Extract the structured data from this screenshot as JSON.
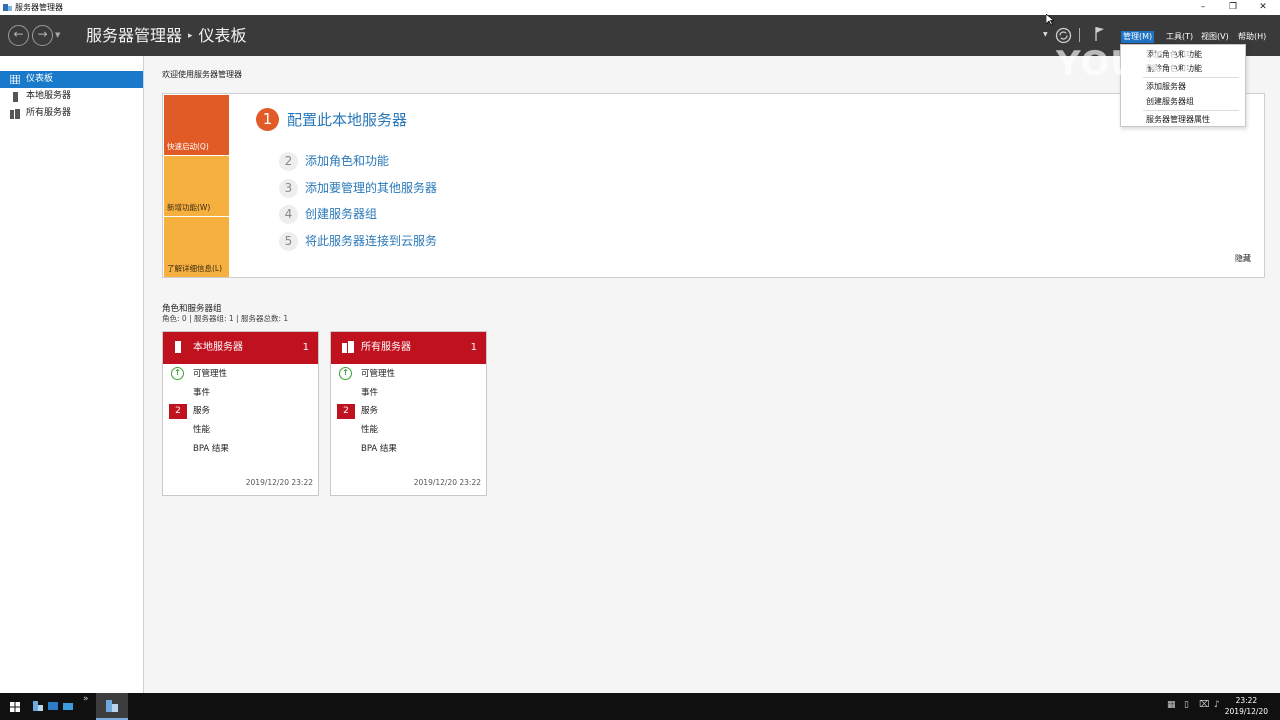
{
  "window": {
    "title": "服务器管理器",
    "minimize_glyph": "–",
    "restore_glyph": "❐",
    "close_glyph": "✕"
  },
  "header": {
    "app_name": "服务器管理器",
    "separator": "▸",
    "page": "仪表板",
    "menus": {
      "manage": "管理(M)",
      "tools": "工具(T)",
      "view": "视图(V)",
      "help": "帮助(H)"
    }
  },
  "manage_menu": {
    "items": [
      "添加角色和功能",
      "删除角色和功能",
      "添加服务器",
      "创建服务器组",
      "服务器管理器属性"
    ]
  },
  "sidebar": {
    "items": [
      {
        "label": "仪表板",
        "icon": "dashboard-icon"
      },
      {
        "label": "本地服务器",
        "icon": "server-icon"
      },
      {
        "label": "所有服务器",
        "icon": "servers-icon"
      }
    ]
  },
  "welcome": {
    "title": "欢迎使用服务器管理器",
    "tiles": [
      "快速启动(Q)",
      "新增功能(W)",
      "了解详细信息(L)"
    ],
    "step1": {
      "num": "1",
      "label": "配置此本地服务器"
    },
    "steps": [
      {
        "num": "2",
        "label": "添加角色和功能"
      },
      {
        "num": "3",
        "label": "添加要管理的其他服务器"
      },
      {
        "num": "4",
        "label": "创建服务器组"
      },
      {
        "num": "5",
        "label": "将此服务器连接到云服务"
      }
    ],
    "hide": "隐藏"
  },
  "roles": {
    "title": "角色和服务器组",
    "subtitle": "角色: 0 | 服务器组: 1 | 服务器总数: 1",
    "cards": [
      {
        "title": "本地服务器",
        "count": "1",
        "rows": [
          "可管理性",
          "事件",
          "服务",
          "性能",
          "BPA 结果"
        ],
        "badge": "2",
        "timestamp": "2019/12/20 23:22"
      },
      {
        "title": "所有服务器",
        "count": "1",
        "rows": [
          "可管理性",
          "事件",
          "服务",
          "性能",
          "BPA 结果"
        ],
        "badge": "2",
        "timestamp": "2019/12/20 23:22"
      }
    ]
  },
  "taskbar": {
    "time": "23:22",
    "date": "2019/12/20"
  },
  "watermark": "YOUKU",
  "colors": {
    "header_bg": "#3a3a3a",
    "accent_blue": "#1979ca",
    "tile_orange": "#e15b26",
    "tile_yellow": "#f6b040",
    "card_red": "#c0111f",
    "link_blue": "#2a78b9"
  }
}
